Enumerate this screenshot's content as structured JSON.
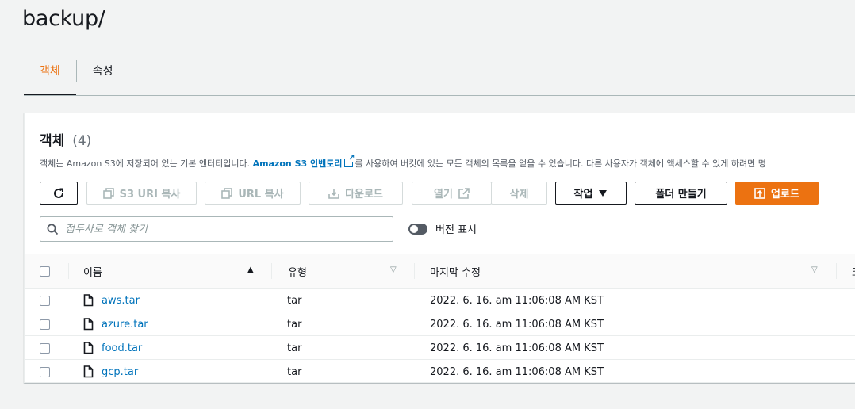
{
  "header": {
    "title": "backup/"
  },
  "tabs": [
    {
      "label": "객체",
      "active": true
    },
    {
      "label": "속성",
      "active": false
    }
  ],
  "panel": {
    "title": "객체",
    "count": "(4)",
    "description": {
      "before": "객체는 Amazon S3에 저장되어 있는 기본 엔터티입니다. ",
      "link": "Amazon S3 인벤토리",
      "after": "를 사용하여 버킷에 있는 모든 객체의 목록을 얻을 수 있습니다. 다른 사용자가 객체에 액세스할 수 있게 하려면 명"
    }
  },
  "toolbar": {
    "refresh_icon": "refresh-icon",
    "copy_s3_uri": "S3 URI 복사",
    "copy_url": "URL 복사",
    "download": "다운로드",
    "open": "열기",
    "delete": "삭제",
    "actions": "작업",
    "create_folder": "폴더 만들기",
    "upload": "업로드"
  },
  "search": {
    "placeholder": "접두사로 객체 찾기"
  },
  "versions_toggle": {
    "label": "버전 표시",
    "on": false
  },
  "table": {
    "columns": [
      "이름",
      "유형",
      "마지막 수정",
      "크"
    ],
    "rows": [
      {
        "name": "aws.tar",
        "type": "tar",
        "modified": "2022. 6. 16. am 11:06:08 AM KST"
      },
      {
        "name": "azure.tar",
        "type": "tar",
        "modified": "2022. 6. 16. am 11:06:08 AM KST"
      },
      {
        "name": "food.tar",
        "type": "tar",
        "modified": "2022. 6. 16. am 11:06:08 AM KST"
      },
      {
        "name": "gcp.tar",
        "type": "tar",
        "modified": "2022. 6. 16. am 11:06:08 AM KST"
      }
    ]
  },
  "colors": {
    "accent": "#ec7211",
    "link": "#0073bb",
    "text": "#16191f",
    "disabled": "#aab7b8"
  }
}
